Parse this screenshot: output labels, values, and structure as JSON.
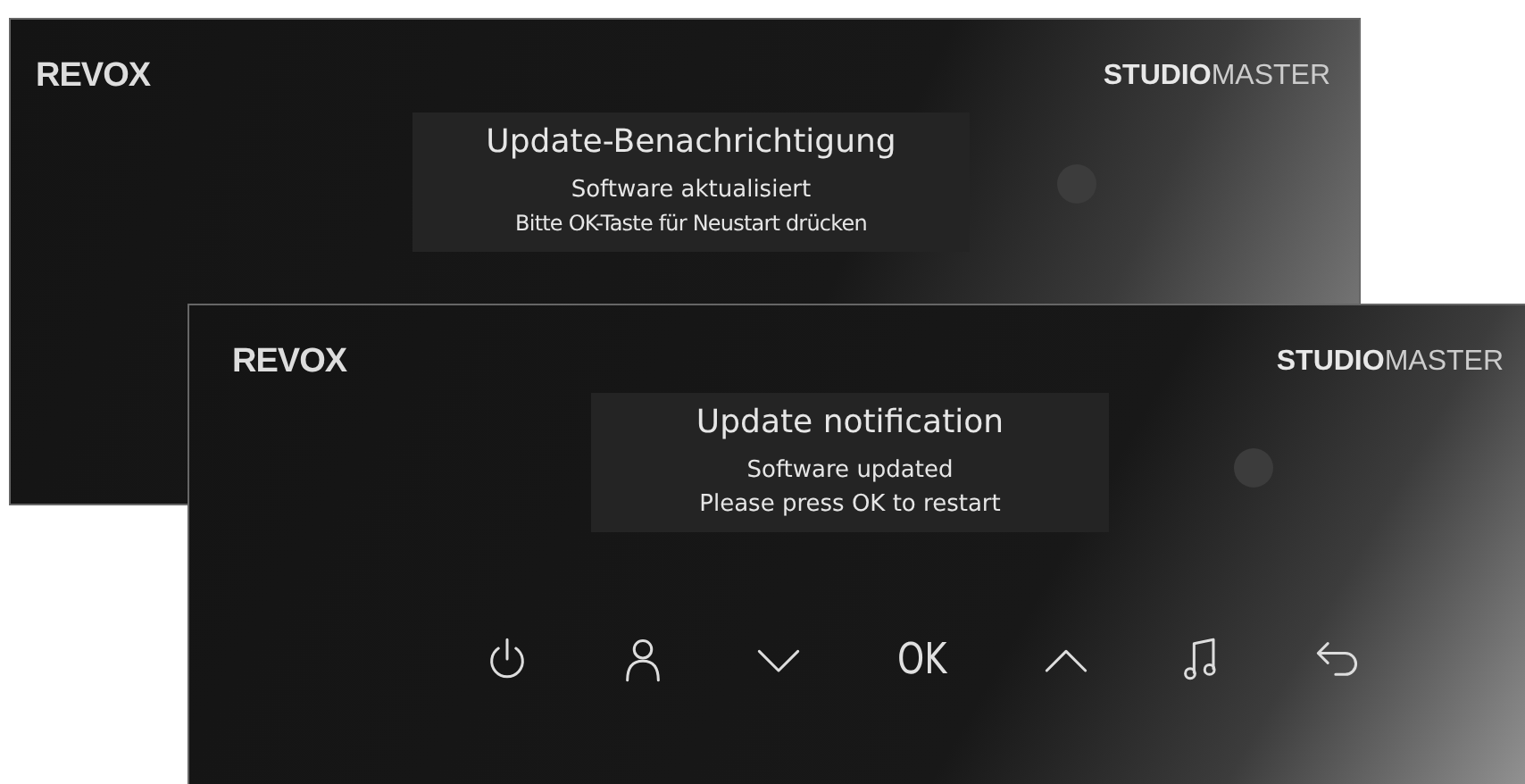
{
  "panels": [
    {
      "logo": "REVOX",
      "brand": "**STUDIO**MASTER",
      "notification": {
        "title": "Update-Benachrichtigung",
        "lines": [
          "Software aktualisiert",
          "Bitte OK-Taste für Neustart drücken"
        ]
      }
    },
    {
      "logo": "REVOX",
      "brand": "**STUDIO**MASTER",
      "notification": {
        "title": "Update notification",
        "lines": [
          "Software updated",
          "Please press OK to restart"
        ]
      },
      "buttons": [
        {
          "kind": "power"
        },
        {
          "kind": "person"
        },
        {
          "kind": "down"
        },
        {
          "kind": "text",
          "label": "OK"
        },
        {
          "kind": "up"
        },
        {
          "kind": "music"
        },
        {
          "kind": "back"
        }
      ]
    }
  ]
}
